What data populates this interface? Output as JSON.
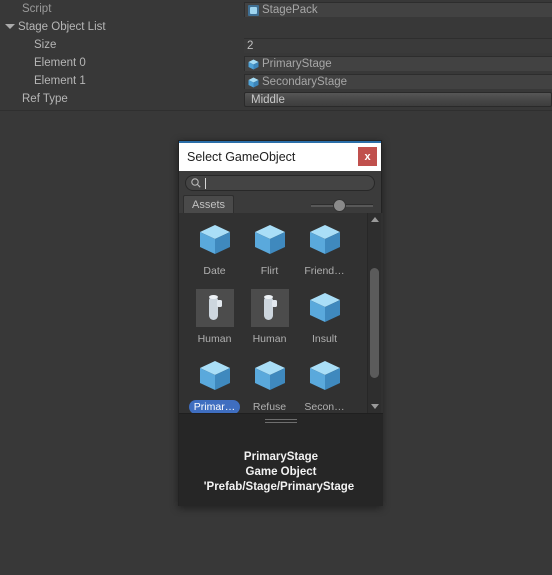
{
  "inspector": {
    "rows": [
      {
        "label": "Script",
        "indent": 0,
        "value": "StagePack",
        "icon": "script-icon",
        "field": "object"
      },
      {
        "label": "Stage Object List",
        "indent": 0,
        "value": "",
        "icon": "",
        "field": "none",
        "foldout": true
      },
      {
        "label": "Size",
        "indent": 1,
        "value": "2",
        "icon": "",
        "field": "plain"
      },
      {
        "label": "Element 0",
        "indent": 1,
        "value": "PrimaryStage",
        "icon": "cube-icon",
        "field": "object"
      },
      {
        "label": "Element 1",
        "indent": 1,
        "value": "SecondaryStage",
        "icon": "cube-icon",
        "field": "object"
      },
      {
        "label": "Ref Type",
        "indent": 0,
        "value": "Middle",
        "icon": "",
        "field": "popup"
      }
    ]
  },
  "dialog": {
    "title": "Select GameObject",
    "close_label": "x",
    "search": {
      "value": "",
      "placeholder": ""
    },
    "search_icon": "search-icon",
    "tabs": [
      {
        "label": "Assets",
        "selected": true
      }
    ],
    "zoom_slider": {
      "value": 40
    },
    "grid_items": [
      {
        "label": "Date",
        "icon": "cube-icon",
        "selected": false
      },
      {
        "label": "Flirt",
        "icon": "cube-icon",
        "selected": false
      },
      {
        "label": "Friend…",
        "icon": "cube-icon",
        "selected": false
      },
      {
        "label": "Human",
        "icon": "preview-icon",
        "selected": false
      },
      {
        "label": "Human",
        "icon": "preview-icon",
        "selected": false
      },
      {
        "label": "Insult",
        "icon": "cube-icon",
        "selected": false
      },
      {
        "label": "Primar…",
        "icon": "cube-icon",
        "selected": true
      },
      {
        "label": "Refuse",
        "icon": "cube-icon",
        "selected": false
      },
      {
        "label": "Secon…",
        "icon": "cube-icon",
        "selected": false
      }
    ],
    "info": {
      "name": "PrimaryStage",
      "type": "Game Object",
      "path": "'Prefab/Stage/PrimaryStage"
    }
  },
  "colors": {
    "background": "#383838",
    "dialog_bg": "#333333",
    "titlebar": "#ffffff",
    "accent_blue": "#2b6ea8",
    "close_red": "#c0504d",
    "selection_blue": "#3f6ec0",
    "cube_blue": "#6fb9e6"
  }
}
